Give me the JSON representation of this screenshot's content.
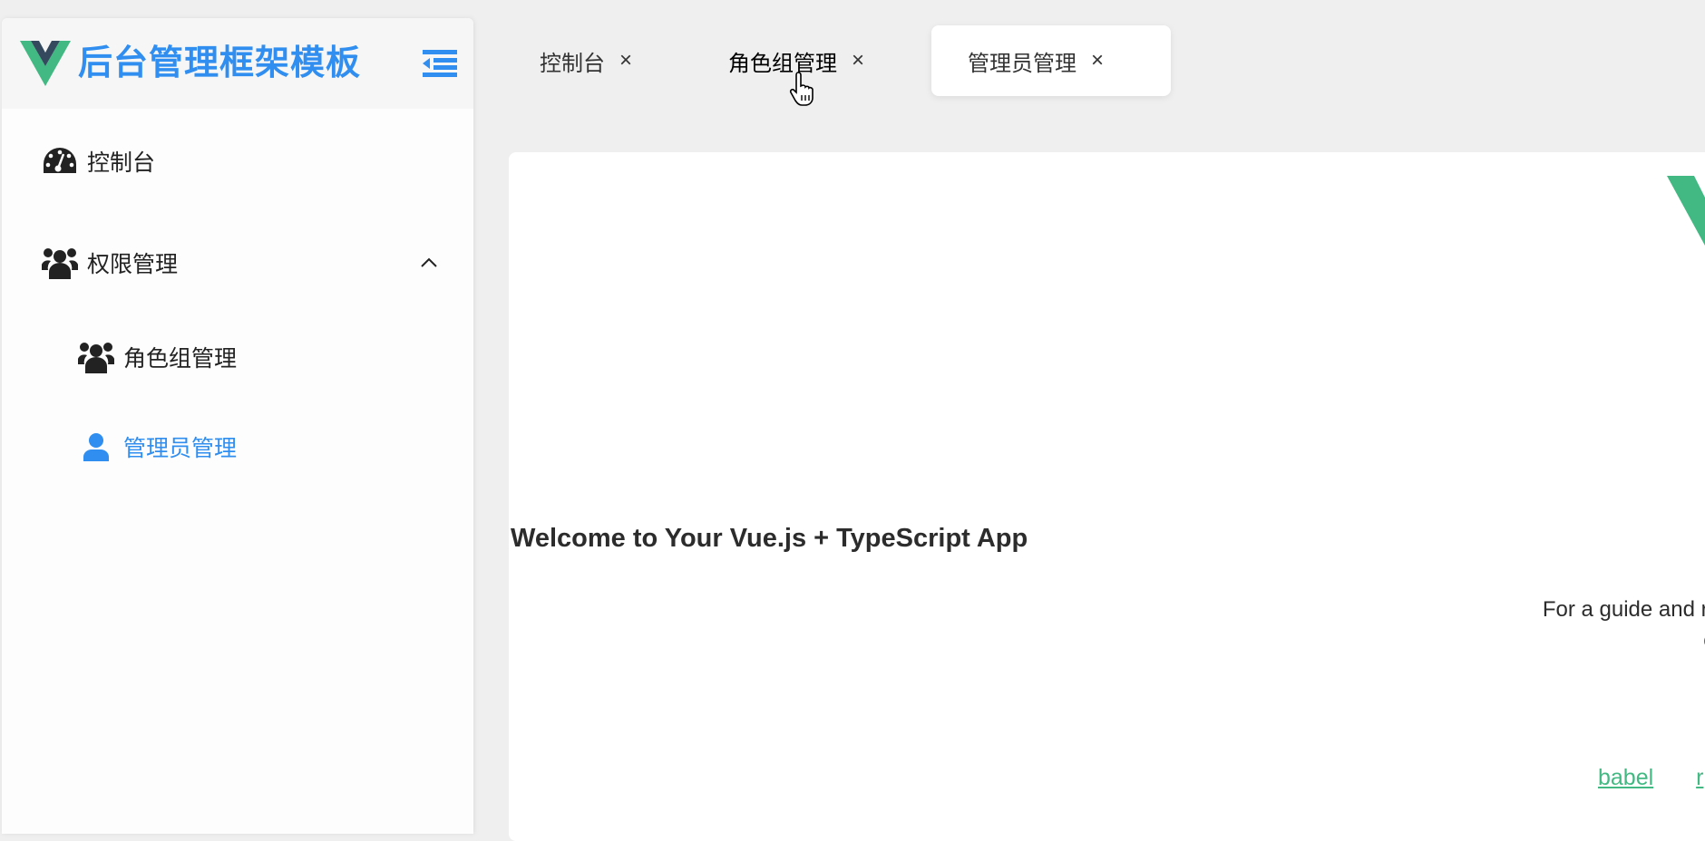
{
  "sidebar": {
    "title": "后台管理框架模板",
    "items": [
      {
        "label": "控制台",
        "icon": "dashboard-icon"
      },
      {
        "label": "权限管理",
        "icon": "users-icon",
        "expanded": true
      },
      {
        "label": "角色组管理",
        "icon": "users-icon"
      },
      {
        "label": "管理员管理",
        "icon": "user-icon",
        "active": true
      }
    ]
  },
  "tabs": [
    {
      "label": "控制台",
      "close": "×"
    },
    {
      "label": "角色组管理",
      "close": "×"
    },
    {
      "label": "管理员管理",
      "close": "×",
      "active": true
    }
  ],
  "content": {
    "heading": "Welcome to Your Vue.js + TypeScript App",
    "guide_line1": "For a guide and recipe",
    "guide_line2": "check",
    "links": [
      "babel",
      "r"
    ]
  },
  "colors": {
    "accent": "#2f8ef0",
    "vue_green": "#42b983",
    "vue_dark": "#35495e"
  }
}
